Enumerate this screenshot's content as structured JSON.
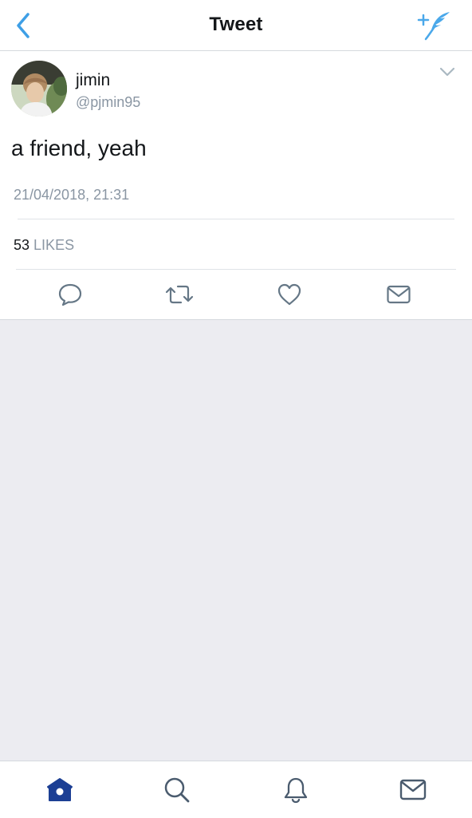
{
  "header": {
    "title": "Tweet",
    "back_icon": "chevron-left-icon",
    "compose_icon": "compose-tweet-icon"
  },
  "tweet": {
    "user": {
      "name": "jimin",
      "handle": "@pjmin95"
    },
    "text": "a friend, yeah",
    "timestamp": "21/04/2018, 21:31",
    "likes_count": "53",
    "likes_label": "LIKES",
    "actions": [
      "reply-icon",
      "retweet-icon",
      "like-icon",
      "direct-message-icon"
    ]
  },
  "tabbar": {
    "tabs": [
      "home-icon",
      "search-icon",
      "notifications-icon",
      "messages-icon"
    ],
    "active": "home-icon"
  },
  "colors": {
    "accent": "#1da1f2",
    "tab_active": "#1c3f94",
    "icon_gray": "#657786",
    "secondary_text": "#8a96a3",
    "background": "#ececf1"
  }
}
